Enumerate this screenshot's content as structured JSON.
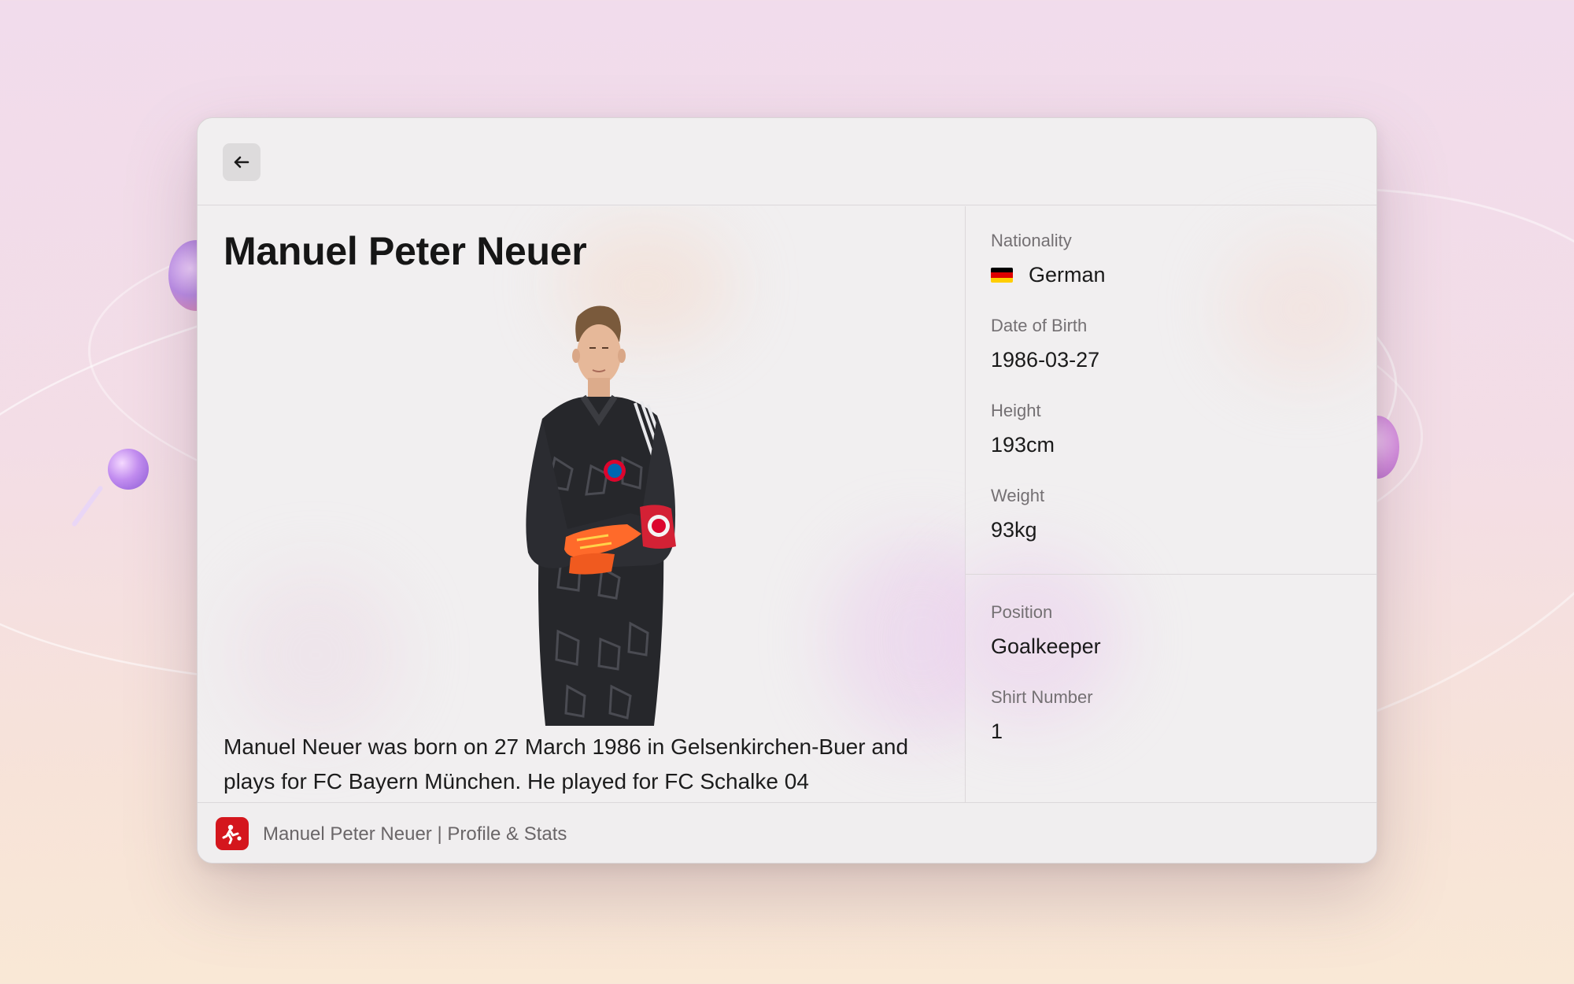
{
  "window": {
    "back_button": {
      "icon": "arrow-left-icon"
    }
  },
  "profile": {
    "name": "Manuel Peter Neuer",
    "photo": {
      "icon": "player-portrait",
      "kit_colors": {
        "shirt": "#26272b",
        "gloves": "#ff6a2a",
        "armband": "#d42135"
      }
    },
    "bio": "Manuel Neuer was born on 27 March 1986 in Gelsenkirchen-Buer and plays for FC Bayern München. He played for FC Schalke 04"
  },
  "details": {
    "nationality_label": "Nationality",
    "nationality_value": "German",
    "nationality_flag": {
      "icon": "germany-flag-icon",
      "colors": [
        "#000000",
        "#dd0000",
        "#ffce00"
      ]
    },
    "dob_label": "Date of Birth",
    "dob_value": "1986-03-27",
    "height_label": "Height",
    "height_value": "193cm",
    "weight_label": "Weight",
    "weight_value": "93kg",
    "position_label": "Position",
    "position_value": "Goalkeeper",
    "shirt_label": "Shirt Number",
    "shirt_value": "1"
  },
  "footer": {
    "app_icon": {
      "icon": "bundesliga-logo-icon",
      "color": "#d4161d"
    },
    "title": "Manuel Peter Neuer | Profile & Stats"
  }
}
